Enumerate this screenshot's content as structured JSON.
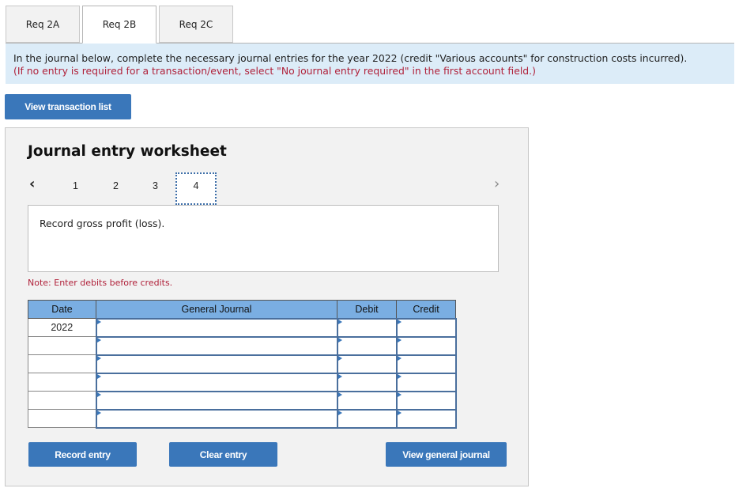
{
  "tabs": [
    {
      "label": "Req 2A",
      "active": false
    },
    {
      "label": "Req 2B",
      "active": true
    },
    {
      "label": "Req 2C",
      "active": false
    }
  ],
  "instructions": {
    "line1": "In the journal below, complete the necessary journal entries for the year 2022 (credit \"Various accounts\" for construction costs incurred).",
    "line2": "(If no entry is required for a transaction/event, select \"No journal entry required\" in the first account field.)"
  },
  "buttons": {
    "view_transactions": "View transaction list",
    "record_entry": "Record entry",
    "clear_entry": "Clear entry",
    "view_general_journal": "View general journal"
  },
  "worksheet": {
    "title": "Journal entry worksheet",
    "pages": [
      "1",
      "2",
      "3",
      "4"
    ],
    "active_page": "4",
    "prev_icon": "‹",
    "next_icon": "›",
    "description": "Record gross profit (loss).",
    "note": "Note: Enter debits before credits."
  },
  "journal_table": {
    "headers": {
      "date": "Date",
      "account": "General Journal",
      "debit": "Debit",
      "credit": "Credit"
    },
    "rows": [
      {
        "date": "2022",
        "account": "",
        "debit": "",
        "credit": ""
      },
      {
        "date": "",
        "account": "",
        "debit": "",
        "credit": ""
      },
      {
        "date": "",
        "account": "",
        "debit": "",
        "credit": ""
      },
      {
        "date": "",
        "account": "",
        "debit": "",
        "credit": ""
      },
      {
        "date": "",
        "account": "",
        "debit": "",
        "credit": ""
      },
      {
        "date": "",
        "account": "",
        "debit": "",
        "credit": ""
      }
    ]
  }
}
